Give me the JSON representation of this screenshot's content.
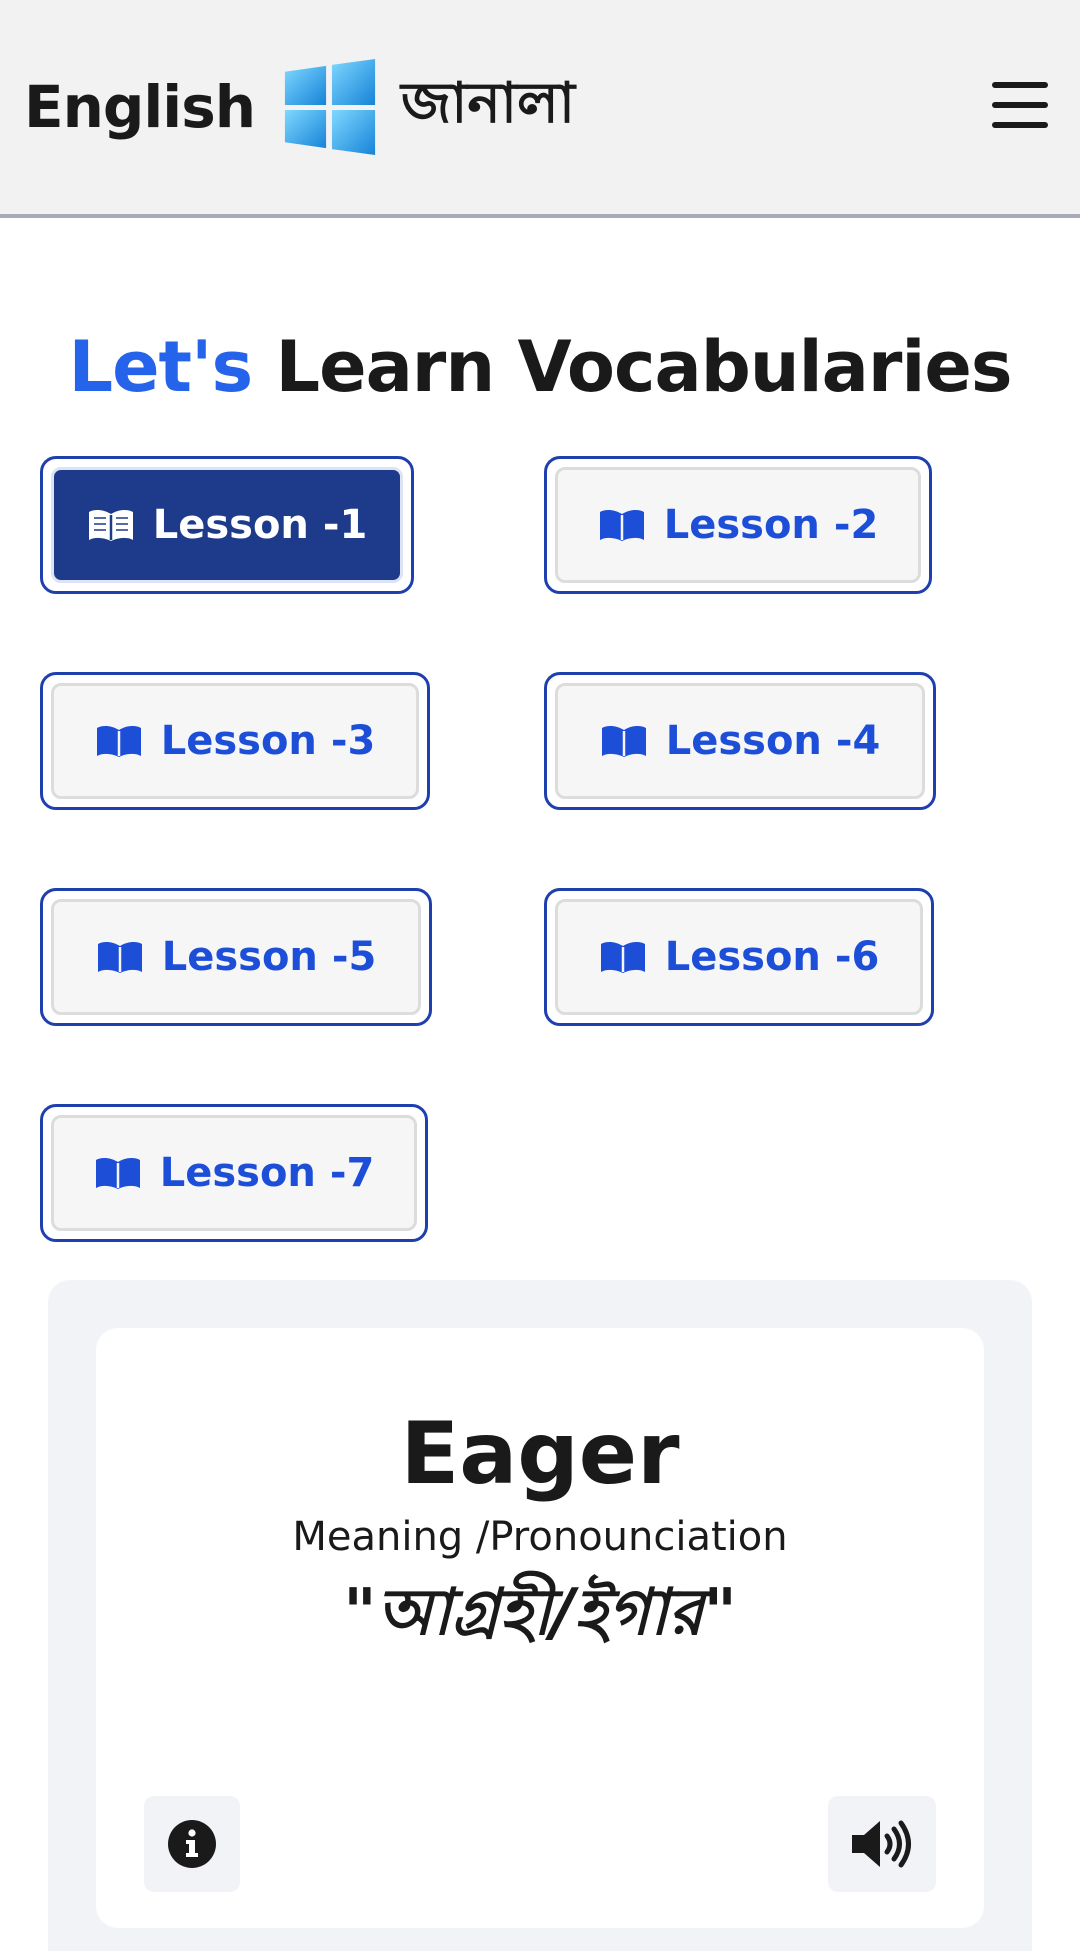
{
  "navbar": {
    "brand_english": "English",
    "brand_bangla": "জানালা",
    "logo_icon": "windows-logo-icon",
    "menu_icon": "hamburger-menu-icon"
  },
  "heading": {
    "accent": "Let's",
    "rest": "Learn Vocabularies"
  },
  "lessons": {
    "active_index": 0,
    "items": [
      {
        "label": "Lesson -1"
      },
      {
        "label": "Lesson -2"
      },
      {
        "label": "Lesson -3"
      },
      {
        "label": "Lesson -4"
      },
      {
        "label": "Lesson -5"
      },
      {
        "label": "Lesson -6"
      },
      {
        "label": "Lesson -7"
      }
    ]
  },
  "card": {
    "word": "Eager",
    "meaning_label": "Meaning /Pronounciation",
    "meaning": "\"আগ্রহী/ইগার\"",
    "info_icon": "info-icon",
    "speaker_icon": "speaker-icon"
  },
  "colors": {
    "accent": "#2563eb",
    "active_button": "#1e3a8a",
    "button_border": "#1e40af",
    "navbar_bg": "#f2f2f2"
  }
}
